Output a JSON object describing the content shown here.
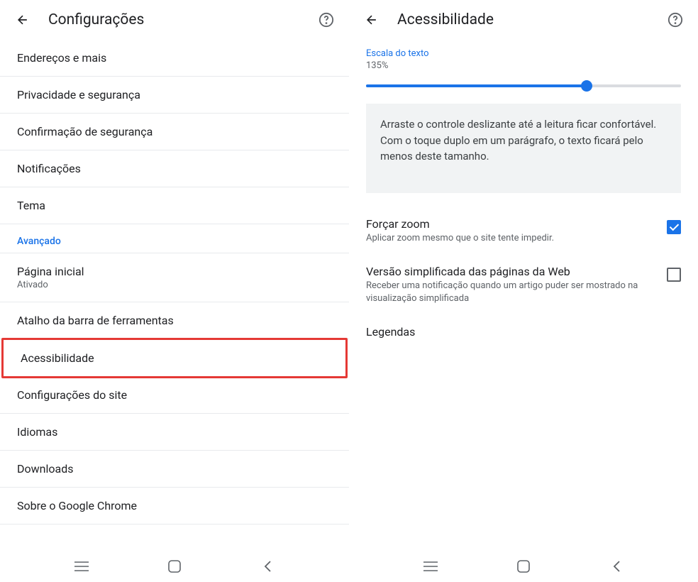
{
  "left": {
    "header": {
      "title": "Configurações"
    },
    "items": [
      {
        "label": "Endereços e mais"
      },
      {
        "label": "Privacidade e segurança"
      },
      {
        "label": "Confirmação de segurança"
      },
      {
        "label": "Notificações"
      },
      {
        "label": "Tema"
      }
    ],
    "advanced_label": "Avançado",
    "advanced_items": [
      {
        "label": "Página inicial",
        "sublabel": "Ativado"
      },
      {
        "label": "Atalho da barra de ferramentas"
      },
      {
        "label": "Acessibilidade",
        "highlighted": true
      },
      {
        "label": "Configurações do site"
      },
      {
        "label": "Idiomas"
      },
      {
        "label": "Downloads"
      },
      {
        "label": "Sobre o Google Chrome"
      }
    ]
  },
  "right": {
    "header": {
      "title": "Acessibilidade"
    },
    "text_scale": {
      "label": "Escala do texto",
      "value": "135%",
      "info": "Arraste o controle deslizante até a leitura ficar confortável. Com o toque duplo em um parágrafo, o texto ficará pelo menos deste tamanho."
    },
    "force_zoom": {
      "title": "Forçar zoom",
      "sub": "Aplicar zoom mesmo que o site tente impedir.",
      "checked": true
    },
    "simplified": {
      "title": "Versão simplificada das páginas da Web",
      "sub": "Receber uma notificação quando um artigo puder ser mostrado na visualização simplificada",
      "checked": false
    },
    "captions": {
      "title": "Legendas"
    }
  }
}
